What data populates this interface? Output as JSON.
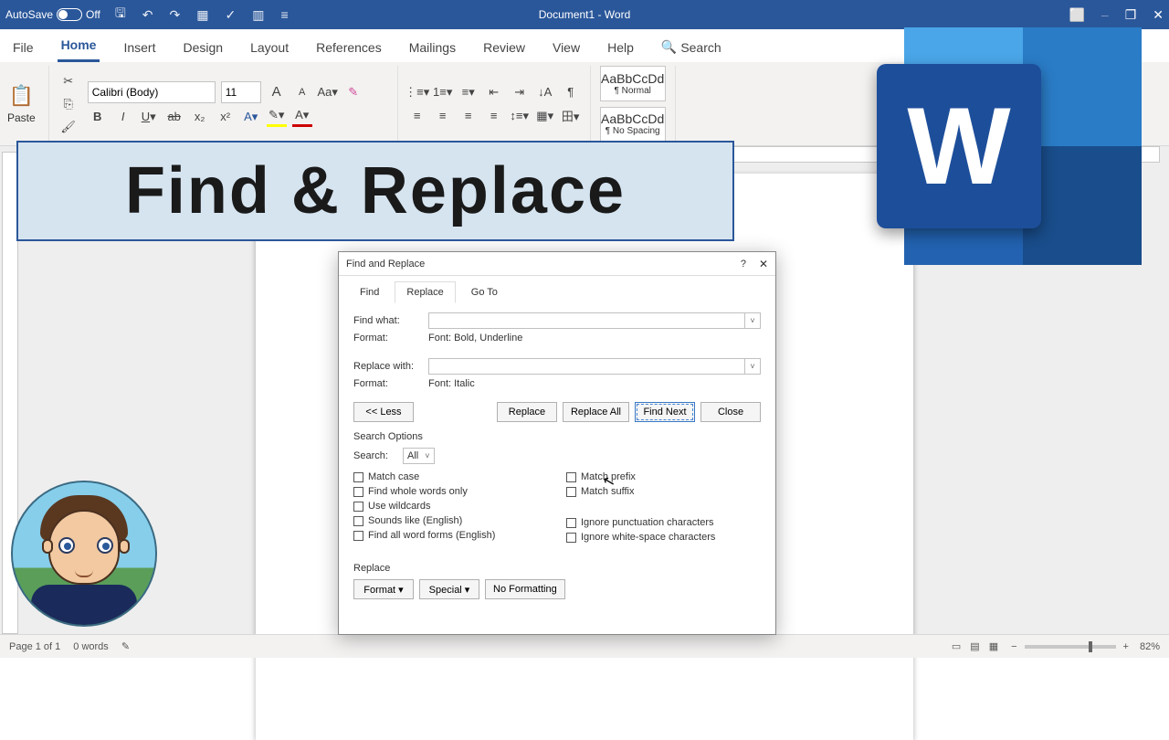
{
  "titlebar": {
    "autosave": {
      "label": "AutoSave",
      "state": "Off"
    },
    "document": "Document1  -  Word"
  },
  "ribbon_tabs": {
    "file": "File",
    "home": "Home",
    "insert": "Insert",
    "design": "Design",
    "layout": "Layout",
    "references": "References",
    "mailings": "Mailings",
    "review": "Review",
    "view": "View",
    "help": "Help",
    "search": "Search"
  },
  "ribbon": {
    "paste": "Paste",
    "font_name": "Calibri (Body)",
    "font_size": "11",
    "style1_sample": "AaBbCcDd",
    "style1_name": "¶ Normal",
    "style2_sample": "AaBbCcDd",
    "style2_name": "¶ No Spacing"
  },
  "banner": "Find & Replace",
  "dialog": {
    "title": "Find and Replace",
    "tabs": {
      "find": "Find",
      "replace": "Replace",
      "goto": "Go To"
    },
    "find_what_label": "Find what:",
    "find_format_label": "Format:",
    "find_format_value": "Font: Bold, Underline",
    "replace_with_label": "Replace with:",
    "replace_format_label": "Format:",
    "replace_format_value": "Font: Italic",
    "buttons": {
      "less": "<< Less",
      "replace": "Replace",
      "replace_all": "Replace All",
      "find_next": "Find Next",
      "close": "Close"
    },
    "search_options_title": "Search Options",
    "search_label": "Search:",
    "search_value": "All",
    "checks_left": {
      "match_case": "Match case",
      "whole_words": "Find whole words only",
      "wildcards": "Use wildcards",
      "sounds_like": "Sounds like (English)",
      "word_forms": "Find all word forms (English)"
    },
    "checks_right": {
      "match_prefix": "Match prefix",
      "match_suffix": "Match suffix",
      "ignore_punct": "Ignore punctuation characters",
      "ignore_space": "Ignore white-space characters"
    },
    "footer_title": "Replace",
    "footer_buttons": {
      "format": "Format ▾",
      "special": "Special ▾",
      "no_formatting": "No Formatting"
    }
  },
  "statusbar": {
    "page": "Page 1 of 1",
    "words": "0 words",
    "zoom": "82%"
  }
}
